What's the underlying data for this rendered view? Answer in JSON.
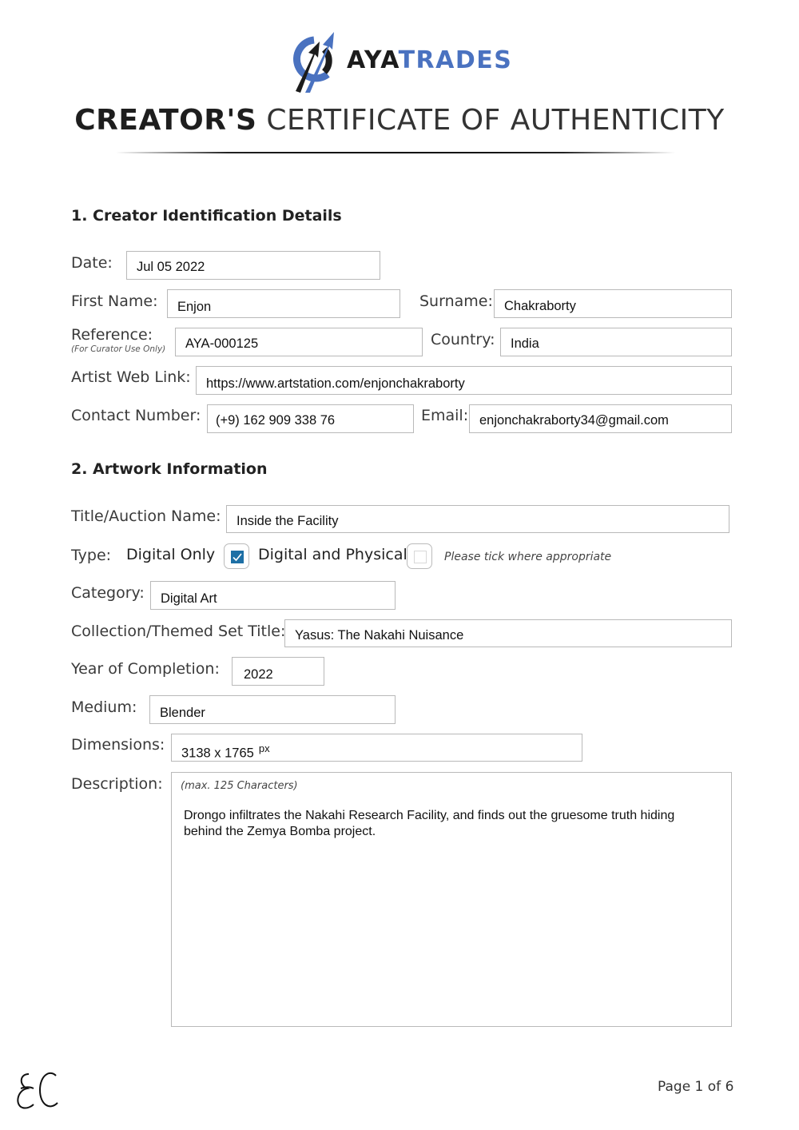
{
  "header": {
    "brand_part1": "AYA",
    "brand_part2": "TRADES",
    "logo_icon": "ayatrades-logo-icon",
    "title_bold": "CREATOR'S",
    "title_light": "CERTIFICATE OF AUTHENTICITY",
    "colors": {
      "brand_blue": "#4a72c0",
      "brand_dark": "#1c1c1c"
    }
  },
  "section1": {
    "heading": "1. Creator Identification Details",
    "date": {
      "label": "Date:",
      "value": "Jul 05 2022"
    },
    "first_name": {
      "label": "First Name:",
      "value": "Enjon"
    },
    "surname": {
      "label": "Surname:",
      "value": "Chakraborty"
    },
    "reference": {
      "label": "Reference:",
      "sublabel": "(For Curator Use Only)",
      "value": "AYA-000125"
    },
    "country": {
      "label": "Country:",
      "value": "India"
    },
    "web_link": {
      "label": "Artist Web Link:",
      "value": "https://www.artstation.com/enjonchakraborty"
    },
    "contact": {
      "label": "Contact Number:",
      "value": "(+9) 162 909 338 76"
    },
    "email": {
      "label": "Email:",
      "value": "enjonchakraborty34@gmail.com"
    }
  },
  "section2": {
    "heading": "2. Artwork Information",
    "title": {
      "label": "Title/Auction Name:",
      "value": "Inside the Facility"
    },
    "type": {
      "label": "Type:",
      "options": [
        {
          "label": "Digital Only",
          "checked": true
        },
        {
          "label": "Digital and Physical",
          "checked": false
        }
      ],
      "hint": "Please tick where appropriate",
      "check_color": "#1d6fa5"
    },
    "category": {
      "label": "Category:",
      "value": "Digital Art"
    },
    "collection": {
      "label": "Collection/Themed Set Title:",
      "value": "Yasus: The Nakahi Nuisance"
    },
    "year": {
      "label": "Year of Completion:",
      "value": "2022"
    },
    "medium": {
      "label": "Medium:",
      "value": "Blender"
    },
    "dimensions": {
      "label": "Dimensions:",
      "value": "3138 x 1765",
      "unit": "px"
    },
    "description": {
      "label": "Description:",
      "hint": "(max. 125 Characters)",
      "value": "Drongo infiltrates the Nakahi Research Facility, and finds out the gruesome truth hiding behind the Zemya Bomba project."
    }
  },
  "footer": {
    "signature_initials": "EC",
    "page_label": "Page 1 of 6"
  }
}
